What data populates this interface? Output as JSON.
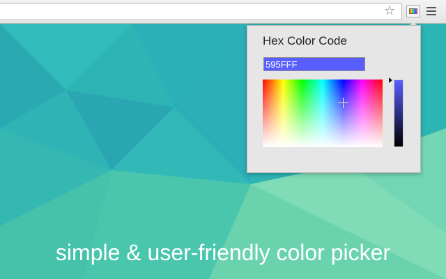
{
  "toolbar": {
    "star_icon": "☆",
    "extension_icon": "color-picker-icon",
    "menu_icon": "hamburger-menu-icon"
  },
  "popup": {
    "title": "Hex Color Code",
    "hex_value": "595FFF",
    "selected_color": "#595fff"
  },
  "caption": "simple & user-friendly color picker",
  "colors": {
    "background_teal": "#2fb6b7",
    "background_green": "#78dba8",
    "popup_bg": "#e6e6e6"
  }
}
